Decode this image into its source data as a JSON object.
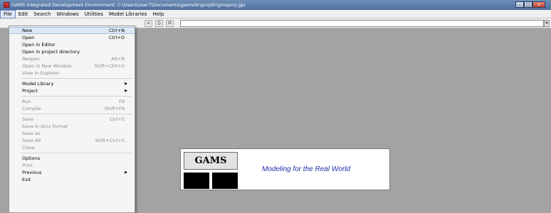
{
  "window": {
    "title": "GAMS Integrated Development Environment: C:\\Users\\user7\\Documents\\gamsdir\\projdir\\gmsproj.gpr",
    "minimize_glyph": "–",
    "maximize_glyph": "□",
    "close_glyph": "x"
  },
  "menubar": [
    "File",
    "Edit",
    "Search",
    "Windows",
    "Utilities",
    "Model Libraries",
    "Help"
  ],
  "toolbar": {
    "glyphs": [
      "a",
      "⎙",
      "⧉"
    ]
  },
  "file_menu": {
    "items": [
      {
        "label": "New",
        "shortcut": "Ctrl+N",
        "enabled": true,
        "highlight": true
      },
      {
        "label": "Open",
        "shortcut": "Ctrl+O",
        "enabled": true
      },
      {
        "label": "Open in Editor",
        "shortcut": "",
        "enabled": true
      },
      {
        "label": "Open in project directory",
        "shortcut": "",
        "enabled": true
      },
      {
        "label": "Reopen",
        "shortcut": "Alt+R",
        "enabled": false
      },
      {
        "label": "Open in New Window",
        "shortcut": "Shift+Ctrl+O",
        "enabled": false
      },
      {
        "label": "View in Explorer",
        "shortcut": "",
        "enabled": false
      },
      {
        "sep": true
      },
      {
        "label": "Model Library",
        "shortcut": "",
        "enabled": true,
        "submenu": true
      },
      {
        "label": "Project",
        "shortcut": "",
        "enabled": true,
        "submenu": true
      },
      {
        "sep": true
      },
      {
        "label": "Run",
        "shortcut": "F9",
        "enabled": false
      },
      {
        "label": "Compile",
        "shortcut": "Shift+F9",
        "enabled": false
      },
      {
        "sep": true
      },
      {
        "label": "Save",
        "shortcut": "Ctrl+S",
        "enabled": false
      },
      {
        "label": "Save in Unix format",
        "shortcut": "",
        "enabled": false
      },
      {
        "label": "Save as",
        "shortcut": "",
        "enabled": false
      },
      {
        "label": "Save All",
        "shortcut": "Shift+Ctrl+S",
        "enabled": false
      },
      {
        "label": "Close",
        "shortcut": "",
        "enabled": false
      },
      {
        "sep": true
      },
      {
        "label": "Options",
        "shortcut": "",
        "enabled": true
      },
      {
        "label": "Print",
        "shortcut": "",
        "enabled": false
      },
      {
        "label": "Previous",
        "shortcut": "",
        "enabled": true,
        "submenu": true
      },
      {
        "label": "Exit",
        "shortcut": "",
        "enabled": true
      }
    ]
  },
  "splash": {
    "logo_text": "GAMS",
    "tagline": "Modeling for the Real World"
  },
  "colors": {
    "workspace": "#a3a3a3",
    "tagline": "#1f2fa6",
    "titlebar": "#4f6f9f"
  }
}
